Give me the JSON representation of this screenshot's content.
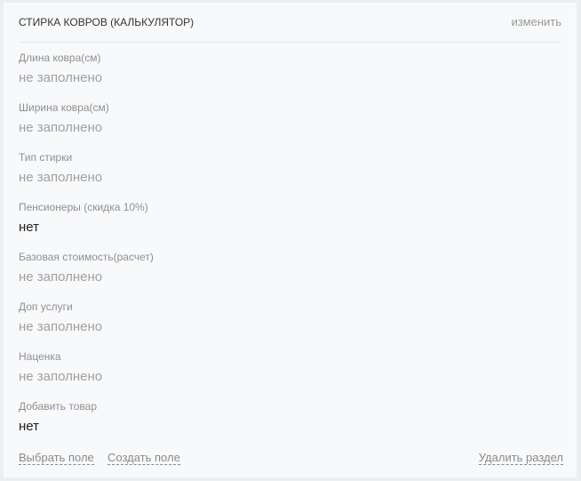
{
  "section": {
    "title": "СТИРКА КОВРОВ (КАЛЬКУЛЯТОР)",
    "edit_label": "изменить"
  },
  "fields": [
    {
      "label": "Длина ковра(см)",
      "value": "не заполнено",
      "filled": false
    },
    {
      "label": "Ширина ковра(см)",
      "value": "не заполнено",
      "filled": false
    },
    {
      "label": "Тип стирки",
      "value": "не заполнено",
      "filled": false
    },
    {
      "label": "Пенсионеры (скидка 10%)",
      "value": "нет",
      "filled": true
    },
    {
      "label": "Базовая стоимость(расчет)",
      "value": "не заполнено",
      "filled": false
    },
    {
      "label": "Доп услуги",
      "value": "не заполнено",
      "filled": false
    },
    {
      "label": "Наценка",
      "value": "не заполнено",
      "filled": false
    },
    {
      "label": "Добавить товар",
      "value": "нет",
      "filled": true
    }
  ],
  "footer": {
    "select_field": "Выбрать поле",
    "create_field": "Создать поле",
    "delete_section": "Удалить раздел"
  }
}
